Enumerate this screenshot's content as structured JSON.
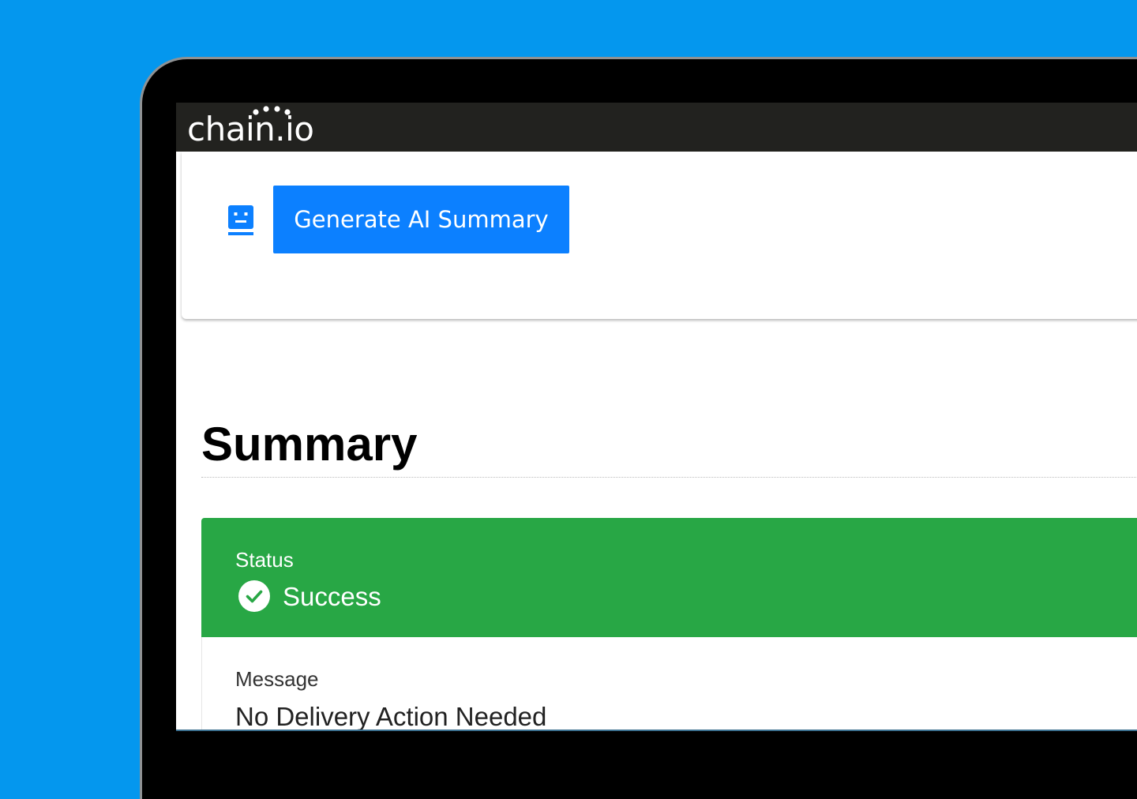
{
  "brand": {
    "name": "chain.io"
  },
  "toolbar": {
    "generate_label": "Generate AI Summary"
  },
  "summary": {
    "title": "Summary",
    "status": {
      "label": "Status",
      "value": "Success"
    },
    "message": {
      "label": "Message",
      "value": "No Delivery Action Needed"
    }
  },
  "icons": {
    "robot": "robot-icon",
    "status": "check-circle-icon"
  },
  "colors": {
    "background": "#0497ee",
    "topbar": "#22221f",
    "accent": "#0c80ff",
    "success": "#28a745"
  }
}
